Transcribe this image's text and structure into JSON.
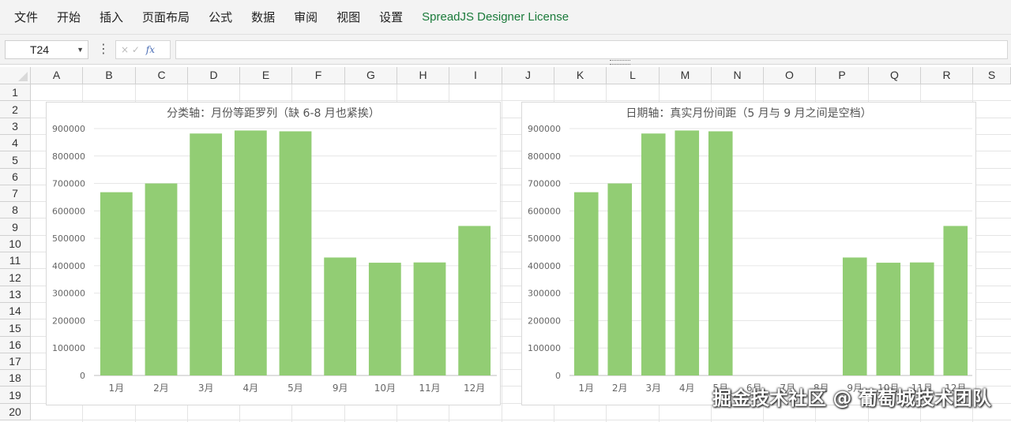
{
  "menu": [
    "文件",
    "开始",
    "插入",
    "页面布局",
    "公式",
    "数据",
    "审阅",
    "视图",
    "设置",
    "SpreadJS Designer License"
  ],
  "formula_bar": {
    "name_box": "T24",
    "more_icon": "vertical-dots-icon",
    "cancel_icon": "×",
    "confirm_icon": "✓",
    "fx_label": "fx",
    "formula": ""
  },
  "grid": {
    "columns": [
      "A",
      "B",
      "C",
      "D",
      "E",
      "F",
      "G",
      "H",
      "I",
      "J",
      "K",
      "L",
      "M",
      "N",
      "O",
      "P",
      "Q",
      "R",
      "S"
    ],
    "rows": [
      "1",
      "2",
      "3",
      "4",
      "5",
      "6",
      "7",
      "8",
      "9",
      "10",
      "11",
      "12",
      "13",
      "14",
      "15",
      "16",
      "17",
      "18",
      "19",
      "20"
    ]
  },
  "colors": {
    "bar": "#92cd74",
    "gridline": "#e6e6e6",
    "axis_text": "#666666"
  },
  "chart_data": [
    {
      "type": "bar",
      "title": "分类轴：月份等距罗列（缺 6-8 月也紧挨）",
      "categories": [
        "1月",
        "2月",
        "3月",
        "4月",
        "5月",
        "9月",
        "10月",
        "11月",
        "12月"
      ],
      "values": [
        668000,
        700000,
        882000,
        893000,
        890000,
        430000,
        411000,
        412000,
        545000
      ],
      "ylim": [
        0,
        900000
      ],
      "yticks": [
        "0",
        "100000",
        "200000",
        "300000",
        "400000",
        "500000",
        "600000",
        "700000",
        "800000",
        "900000"
      ],
      "grid": true,
      "legend": "none"
    },
    {
      "type": "bar",
      "title": "日期轴：真实月份间距（5 月与 9 月之间是空档）",
      "categories": [
        "1月",
        "2月",
        "3月",
        "4月",
        "5月",
        "6月",
        "7月",
        "8月",
        "9月",
        "10月",
        "11月",
        "12月"
      ],
      "values": [
        668000,
        700000,
        882000,
        893000,
        890000,
        null,
        null,
        null,
        430000,
        411000,
        412000,
        545000
      ],
      "ylim": [
        0,
        900000
      ],
      "yticks": [
        "0",
        "100000",
        "200000",
        "300000",
        "400000",
        "500000",
        "600000",
        "700000",
        "800000",
        "900000"
      ],
      "grid": true,
      "legend": "none"
    }
  ],
  "watermark": "掘金技术社区 @ 葡萄城技术团队"
}
